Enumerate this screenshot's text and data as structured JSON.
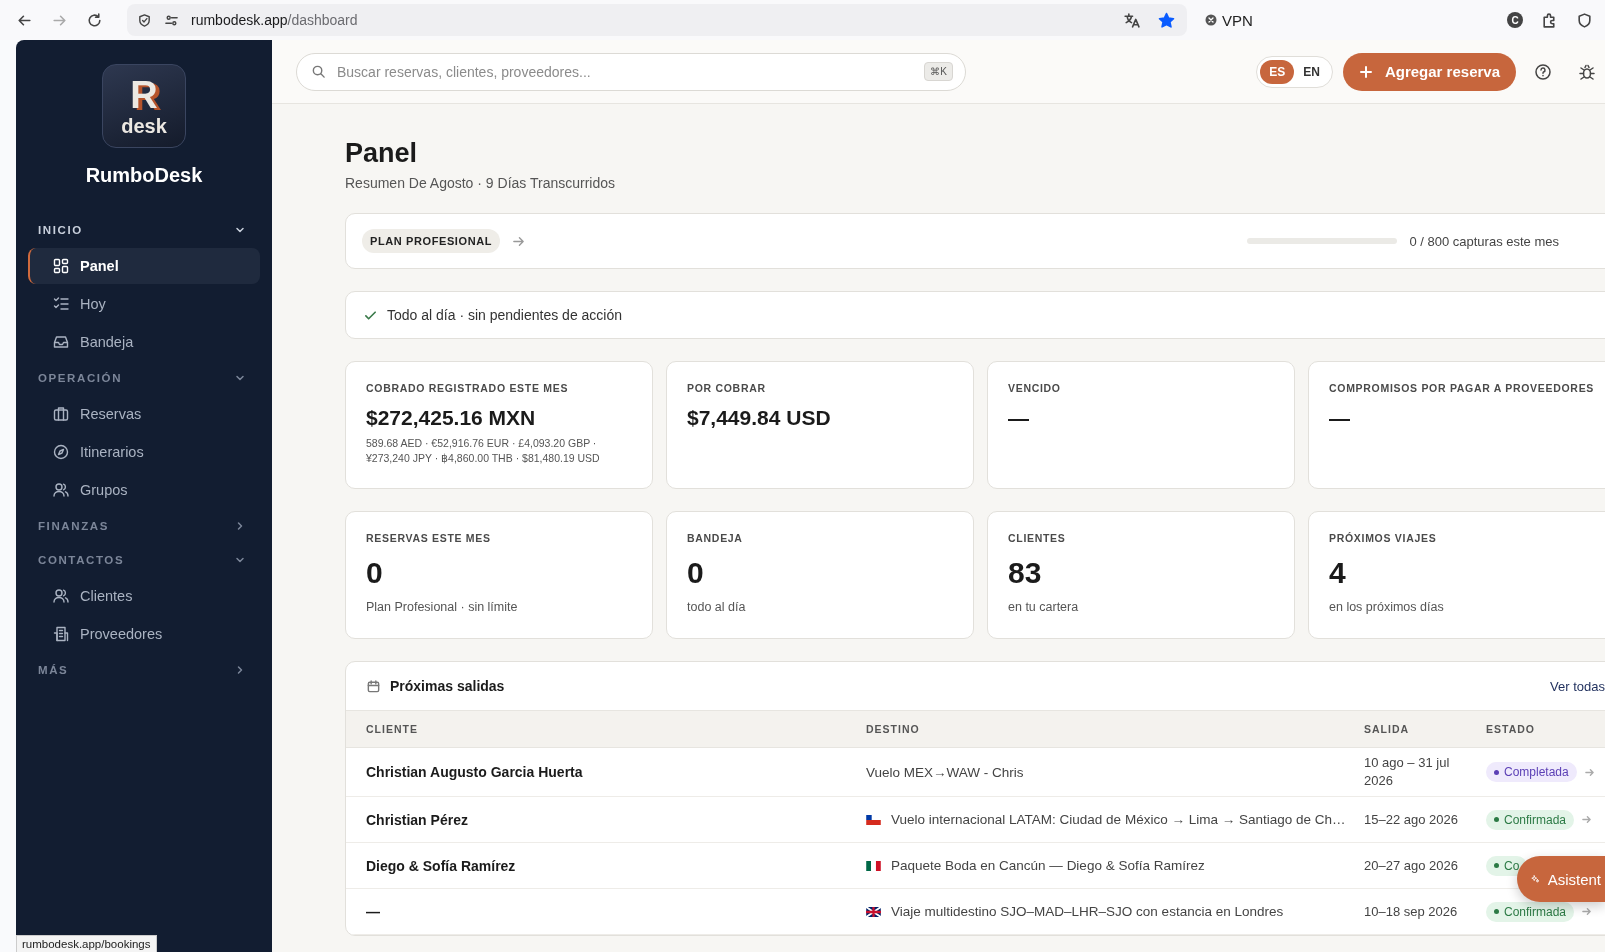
{
  "browser": {
    "url_host": "rumbodesk.app",
    "url_path": "/dashboard",
    "vpn": "VPN",
    "profile": "C"
  },
  "sidebar": {
    "logo_letter": "R",
    "logo_word": "desk",
    "brand": "RumboDesk",
    "sections": [
      {
        "title": "INICIO",
        "expanded": true,
        "items": [
          {
            "label": "Panel",
            "selected": true
          },
          {
            "label": "Hoy",
            "selected": false
          },
          {
            "label": "Bandeja",
            "selected": false
          }
        ]
      },
      {
        "title": "OPERACIÓN",
        "expanded": true,
        "items": [
          {
            "label": "Reservas",
            "selected": false
          },
          {
            "label": "Itinerarios",
            "selected": false
          },
          {
            "label": "Grupos",
            "selected": false
          }
        ]
      },
      {
        "title": "FINANZAS",
        "expanded": false
      },
      {
        "title": "CONTACTOS",
        "expanded": true,
        "items": [
          {
            "label": "Clientes",
            "selected": false
          },
          {
            "label": "Proveedores",
            "selected": false
          }
        ]
      },
      {
        "title": "MÁS",
        "expanded": false
      }
    ]
  },
  "topbar": {
    "search": {
      "placeholder": "Buscar reservas, clientes, proveedores...",
      "shortcut": "⌘K"
    },
    "languages": [
      {
        "label": "ES",
        "selected": true
      },
      {
        "label": "EN",
        "selected": false
      }
    ],
    "add_button": "Agregar reserva"
  },
  "page": {
    "title": "Panel",
    "subtitle": "Resumen De Agosto · 9 Días Transcurridos"
  },
  "plan": {
    "badge": "PLAN PROFESIONAL",
    "level": 0,
    "usage": "0 / 800 capturas este mes"
  },
  "notice": "Todo al día · sin pendientes de acción",
  "cards": [
    {
      "kind": "amount",
      "label": "COBRADO REGISTRADO ESTE MES",
      "value": "$272,425.16 MXN",
      "note": "589.68 AED · €52,916.76 EUR · £4,093.20 GBP · ¥273,240 JPY · ฿4,860.00 THB · $81,480.19 USD"
    },
    {
      "kind": "amount",
      "label": "POR COBRAR",
      "value": "$7,449.84 USD"
    },
    {
      "kind": "amount",
      "label": "VENCIDO",
      "value": "—"
    },
    {
      "kind": "amount",
      "label": "COMPROMISOS POR PAGAR A PROVEEDORES",
      "value": "—"
    },
    {
      "kind": "count",
      "label": "RESERVAS ESTE MES",
      "value": "0",
      "note": "Plan Profesional · sin límite"
    },
    {
      "kind": "count",
      "label": "BANDEJA",
      "value": "0",
      "note": "todo al día"
    },
    {
      "kind": "count",
      "label": "CLIENTES",
      "value": "83",
      "note": "en tu cartera"
    },
    {
      "kind": "count",
      "label": "PRÓXIMOS VIAJES",
      "value": "4",
      "note": "en los próximos días"
    }
  ],
  "departures": {
    "title": "Próximas salidas",
    "link": "Ver todas",
    "columns": [
      "CLIENTE",
      "DESTINO",
      "SALIDA",
      "ESTADO"
    ],
    "rows": [
      {
        "client": "Christian Augusto Garcia Huerta",
        "destination": "Vuelo MEX→WAW - Chris",
        "dates": "10 ago – 31 jul 2026",
        "status": {
          "kind": "done",
          "label": "Completada"
        },
        "arrow": true
      },
      {
        "client": "Christian Pérez",
        "destination": "Vuelo internacional LATAM: Ciudad de México → Lima → Santiago de Ch…",
        "dates": "15–22 ago 2026",
        "status": {
          "kind": "confirmed",
          "label": "Confirmada"
        },
        "arrow": true
      },
      {
        "client": "Diego & Sofía Ramírez",
        "destination": "Paquete Boda en Cancún — Diego & Sofía Ramírez",
        "dates": "20–27 ago 2026",
        "status": {
          "kind": "confirmed",
          "label": "Co"
        },
        "arrow": false
      },
      {
        "client": "—",
        "destination": "Viaje multidestino SJO–MAD–LHR–SJO con estancia en Londres",
        "dates": "10–18 sep 2026",
        "status": {
          "kind": "confirmed",
          "label": "Confirmada"
        },
        "arrow": true
      }
    ]
  },
  "assistant_button": "Asistent",
  "status_link": "rumbodesk.app/bookings"
}
